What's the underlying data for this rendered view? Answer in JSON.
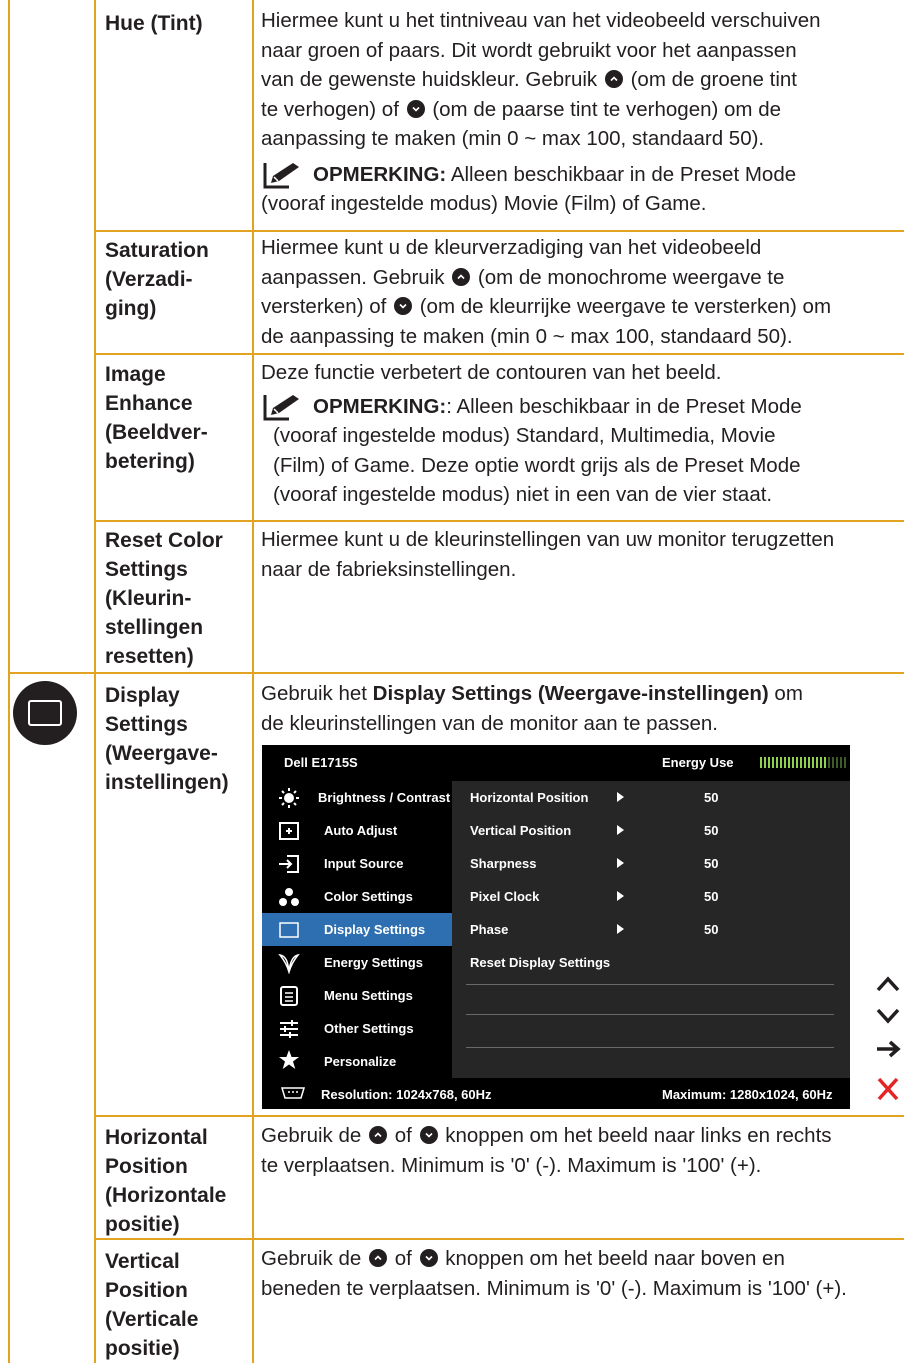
{
  "colors": {
    "accent": "#e2a321",
    "osd_active": "#2d6fb0",
    "text": "#231f20",
    "close": "#e32526"
  },
  "rows": [
    {
      "name": "Hue (Tint)",
      "desc": [
        "Hiermee kunt u het tintniveau van het videobeeld verschuiven",
        "naar groen of paars. Dit wordt gebruikt voor het aanpassen",
        "van de gewenste huidskleur. Gebruik",
        "(om de groene tint",
        "te verhogen) of",
        "(om de paarse tint te verhogen) om de",
        "aanpassing te maken (min 0 ~ max 100, standaard 50)."
      ],
      "note_title": "OPMERKING:",
      "note": [
        "Alleen beschikbaar in de Preset Mode",
        "(vooraf ingestelde modus) Movie (Film) of Game."
      ]
    },
    {
      "name": [
        "Saturation",
        "(Verzadi-",
        "ging)"
      ],
      "desc": [
        "Hiermee kunt u de kleurverzadiging van het videobeeld",
        "aanpassen. Gebruik",
        "(om de monochrome weergave te",
        "versterken) of",
        "(om de kleurrijke weergave te versterken) om",
        "de aanpassing te maken (min 0 ~ max 100, standaard 50)."
      ]
    },
    {
      "name": [
        "Image",
        "Enhance",
        "(Beeldver-",
        "betering)"
      ],
      "desc": [
        "Deze functie verbetert de contouren van het beeld."
      ],
      "note_title": "OPMERKING:",
      "note": [
        ": Alleen beschikbaar in de Preset Mode",
        "(vooraf ingestelde modus) Standard, Multimedia, Movie",
        "(Film) of Game. Deze optie wordt grijs als de Preset Mode",
        "(vooraf ingestelde modus) niet in een van de vier staat."
      ]
    },
    {
      "name": [
        "Reset Color",
        "Settings",
        "(Kleurin-",
        "stellingen",
        "resetten)"
      ],
      "desc": [
        "Hiermee kunt u de kleurinstellingen van uw monitor terugzetten",
        "naar de fabrieksinstellingen."
      ]
    },
    {
      "name": [
        "Display",
        "Settings",
        "(Weergave-",
        "instellingen)"
      ],
      "desc_pre": "Gebruik het ",
      "desc_bold": "Display Settings (Weergave-instellingen)",
      "desc_post": " om",
      "desc2": "de kleurinstellingen van de monitor aan te passen."
    },
    {
      "name": [
        "Horizontal",
        "Position",
        "(Horizontale",
        "positie)"
      ],
      "desc": [
        "Gebruik  de",
        "of",
        "knoppen om het beeld naar links en rechts",
        "te verplaatsen. Minimum is '0' (-). Maximum is '100' (+)."
      ]
    },
    {
      "name": [
        "Vertical",
        "Position",
        "(Verticale",
        "positie)"
      ],
      "desc": [
        "Gebruik de",
        "of",
        "knoppen om het beeld naar boven en",
        "beneden te verplaatsen. Minimum is '0' (-). Maximum is '100' (+)."
      ]
    }
  ],
  "osd": {
    "model": "Dell E1715S",
    "energy_label": "Energy Use",
    "energy_level": 0.75,
    "menu": [
      {
        "label": "Brightness / Contrast",
        "icon": "brightness-icon"
      },
      {
        "label": "Auto Adjust",
        "icon": "auto-adjust-icon"
      },
      {
        "label": "Input Source",
        "icon": "input-source-icon"
      },
      {
        "label": "Color Settings",
        "icon": "color-settings-icon"
      },
      {
        "label": "Display Settings",
        "icon": "display-settings-icon",
        "active": true
      },
      {
        "label": "Energy Settings",
        "icon": "energy-settings-icon"
      },
      {
        "label": "Menu Settings",
        "icon": "menu-settings-icon"
      },
      {
        "label": "Other Settings",
        "icon": "other-settings-icon"
      },
      {
        "label": "Personalize",
        "icon": "star-icon"
      }
    ],
    "submenu": [
      {
        "label": "Horizontal Position",
        "value": "50"
      },
      {
        "label": "Vertical Position",
        "value": "50"
      },
      {
        "label": "Sharpness",
        "value": "50"
      },
      {
        "label": "Pixel Clock",
        "value": "50"
      },
      {
        "label": "Phase",
        "value": "50"
      },
      {
        "label": "Reset Display Settings"
      }
    ],
    "resolution": "Resolution: 1024x768, 60Hz",
    "maximum": "Maximum: 1280x1024, 60Hz"
  }
}
